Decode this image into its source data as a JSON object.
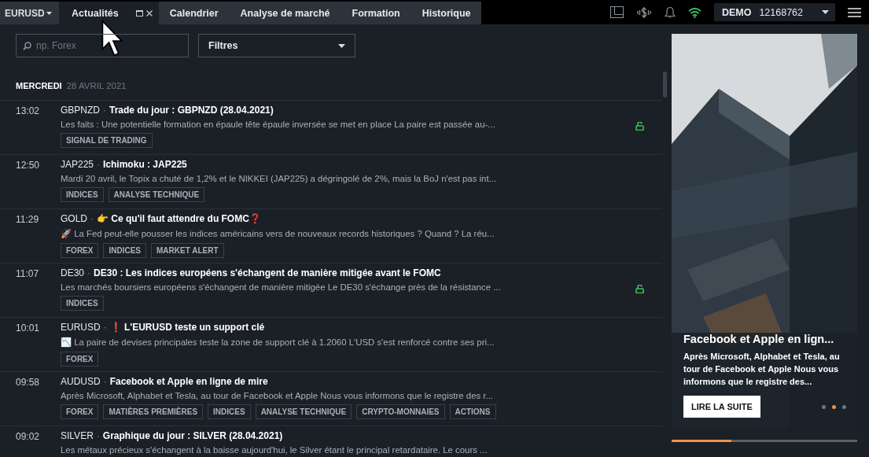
{
  "topbar": {
    "symbol": "EURUSD",
    "tabs": [
      {
        "label": "Actualités",
        "selected": true
      },
      {
        "label": "Calendrier",
        "selected": false
      },
      {
        "label": "Analyse de marché",
        "selected": false
      },
      {
        "label": "Formation",
        "selected": false
      },
      {
        "label": "Historique",
        "selected": false
      }
    ],
    "account": {
      "mode": "DEMO",
      "number": "12168762"
    }
  },
  "filters": {
    "search": {
      "placeholder": "np. Forex"
    },
    "dropdown": "Filtres"
  },
  "date_header": {
    "day": "MERCREDI",
    "date": "28 AVRIL 2021"
  },
  "news": [
    {
      "time": "13:02",
      "symbol": "GBPNZD",
      "separator": "·",
      "title": "Trade du jour : GBPNZD (28.04.2021)",
      "summary": "Les faits : Une potentielle formation en épaule tête épaule inversée se met en place La paire est passée au-...",
      "tags": [
        "SIGNAL DE TRADING"
      ],
      "unlocked": true
    },
    {
      "time": "12:50",
      "symbol": "JAP225",
      "separator": "·",
      "title": "Ichimoku : JAP225",
      "summary": "Mardi 20 avril, le Topix a chuté de 1,2% et le NIKKEI (JAP225) a dégringolé de 2%, mais la BoJ n'est pas int...",
      "tags": [
        "INDICES",
        "ANALYSE TECHNIQUE"
      ],
      "unlocked": false
    },
    {
      "time": "11:29",
      "symbol": "GOLD",
      "separator": "·",
      "title": "👉 Ce qu'il faut attendre du FOMC❓",
      "summary": "🚀 La Fed peut-elle pousser les indices américains vers de nouveaux records historiques ? Quand ? La réu...",
      "tags": [
        "FOREX",
        "INDICES",
        "MARKET ALERT"
      ],
      "unlocked": false
    },
    {
      "time": "11:07",
      "symbol": "DE30",
      "separator": "·",
      "title": "DE30 : Les indices européens s'échangent de manière mitigée avant le FOMC",
      "summary": "Les marchés boursiers européens s'échangent de manière mitigée Le DE30 s'échange près de la résistance ...",
      "tags": [
        "INDICES"
      ],
      "unlocked": true
    },
    {
      "time": "10:01",
      "symbol": "EURUSD",
      "separator": "·",
      "title": "❗ L'EURUSD teste un support clé",
      "summary": "📉 La paire de devises principales teste la zone de support clé à 1.2060 L'USD s'est renforcé contre ses pri...",
      "tags": [
        "FOREX"
      ],
      "unlocked": false
    },
    {
      "time": "09:58",
      "symbol": "AUDUSD",
      "separator": "·",
      "title": "Facebook et Apple en ligne de mire",
      "summary": "Après Microsoft, Alphabet et Tesla, au tour de Facebook et Apple Nous vous informons que le registre des r...",
      "tags": [
        "FOREX",
        "MATIÈRES PREMIÈRES",
        "INDICES",
        "ANALYSE TECHNIQUE",
        "CRYPTO-MONNAIES",
        "ACTIONS"
      ],
      "unlocked": false
    },
    {
      "time": "09:02",
      "symbol": "SILVER",
      "separator": "·",
      "title": "Graphique du jour : SILVER (28.04.2021)",
      "summary": "Les métaux précieux s'échangent à la baisse aujourd'hui, le Silver étant le principal retardataire. Le cours ...",
      "unlocked": false
    }
  ],
  "promo": {
    "title": "Facebook et Apple en lign...",
    "text": "Après Microsoft, Alphabet et Tesla, au tour de Facebook et Apple Nous vous informons que le registre des...",
    "button": "LIRE LA SUITE",
    "dots": [
      {
        "selected": false
      },
      {
        "selected": true
      },
      {
        "selected": false
      }
    ],
    "progress": {
      "level": 0.32
    }
  }
}
